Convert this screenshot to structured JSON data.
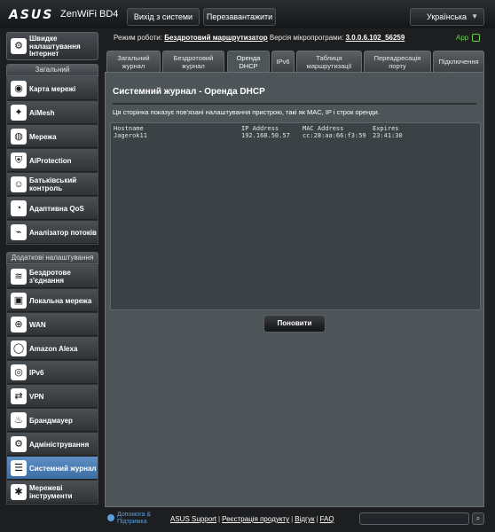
{
  "header": {
    "brand": "ASUS",
    "model": "ZenWiFi BD4",
    "logout_label": "Вихід з системи",
    "reboot_label": "Перезавантажити",
    "language": "Українська"
  },
  "status": {
    "mode_label": "Режим роботи:",
    "mode_value": "Бездротовий маршрутизатор",
    "fw_label": "Версія мікропрограми:",
    "fw_value": "3.0.0.6.102_56259",
    "app_label": "App"
  },
  "sidebar": {
    "quick_setup": "Швидке налаштування Інтернет",
    "general_header": "Загальний",
    "general_items": [
      {
        "label": "Карта мережі",
        "icon": "network-map-icon"
      },
      {
        "label": "AiMesh",
        "icon": "aimesh-icon"
      },
      {
        "label": "Мережа",
        "icon": "network-icon"
      },
      {
        "label": "AiProtection",
        "icon": "aiprotection-icon"
      },
      {
        "label": "Батьківський контроль",
        "icon": "parental-control-icon"
      },
      {
        "label": "Адаптивна QoS",
        "icon": "qos-icon"
      },
      {
        "label": "Аналізатор потоків",
        "icon": "traffic-analyzer-icon"
      }
    ],
    "advanced_header": "Додаткові налаштування",
    "advanced_items": [
      {
        "label": "Бездротове з'єднання",
        "icon": "wireless-icon"
      },
      {
        "label": "Локальна мережа",
        "icon": "lan-icon"
      },
      {
        "label": "WAN",
        "icon": "wan-icon"
      },
      {
        "label": "Amazon Alexa",
        "icon": "alexa-icon"
      },
      {
        "label": "IPv6",
        "icon": "ipv6-icon"
      },
      {
        "label": "VPN",
        "icon": "vpn-icon"
      },
      {
        "label": "Брандмауер",
        "icon": "firewall-icon"
      },
      {
        "label": "Адміністрування",
        "icon": "administration-icon"
      },
      {
        "label": "Системний журнал",
        "icon": "system-log-icon",
        "active": true
      },
      {
        "label": "Мережеві інструменти",
        "icon": "network-tools-icon"
      }
    ]
  },
  "tabs": [
    {
      "label": "Загальний журнал"
    },
    {
      "label": "Бездротовий журнал"
    },
    {
      "label": "Оренда DHCP",
      "active": true
    },
    {
      "label": "IPv6"
    },
    {
      "label": "Таблиця маршрутизації"
    },
    {
      "label": "Переадресація порту"
    },
    {
      "label": "Підключення"
    }
  ],
  "main": {
    "title": "Системний журнал - Оренда DHCP",
    "description": "Ця сторінка показує пов'язані налаштування пристрою, такі як MAC, IP і строк оренди.",
    "columns": [
      "Hostname",
      "IP Address",
      "MAC Address",
      "Expires"
    ],
    "rows": [
      [
        "Jagerok11",
        "192.168.50.57",
        "cc:28:aa:66:f3:59",
        "23:41:30"
      ]
    ],
    "refresh_label": "Поновити"
  },
  "footer": {
    "help_label": "Допомога & Підтримка",
    "links": [
      "ASUS Support",
      "Реєстрація продукту",
      "Відгук",
      "FAQ"
    ],
    "search_value": ""
  }
}
